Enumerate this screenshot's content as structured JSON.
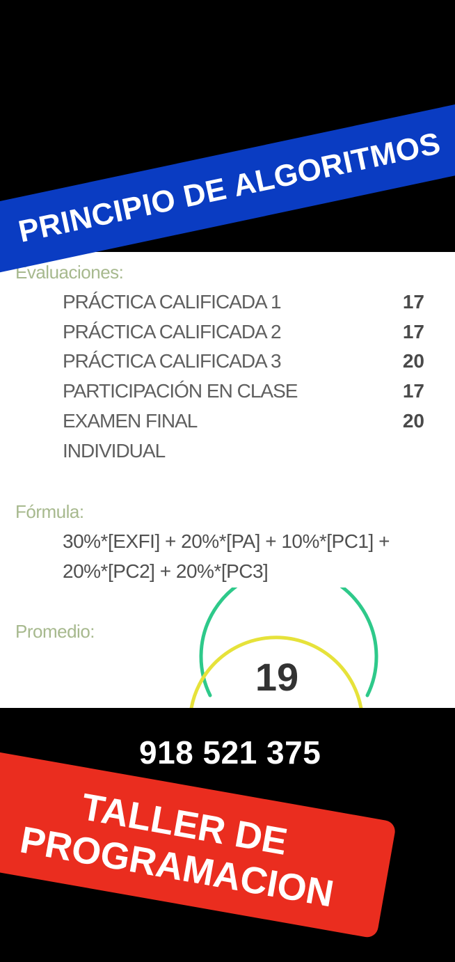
{
  "title_banner": {
    "text": "PRINCIPIO DE ALGORITMOS",
    "color": "#0a3cc2"
  },
  "evaluations": {
    "label": "Evaluaciones:",
    "items": [
      {
        "name": "PRÁCTICA CALIFICADA 1",
        "score": "17"
      },
      {
        "name": "PRÁCTICA CALIFICADA 2",
        "score": "17"
      },
      {
        "name": "PRÁCTICA CALIFICADA 3",
        "score": "20"
      },
      {
        "name": "PARTICIPACIÓN EN CLASE",
        "score": "17"
      },
      {
        "name": "EXAMEN FINAL",
        "name_continued": "INDIVIDUAL",
        "score": "20"
      }
    ]
  },
  "formula": {
    "label": "Fórmula:",
    "line1": "30%*[EXFI] + 20%*[PA] + 10%*[PC1] +",
    "line2": "20%*[PC2] + 20%*[PC3]"
  },
  "average": {
    "label": "Promedio:",
    "value": "19",
    "gauge_colors": {
      "outer": "#2ec98a",
      "inner": "#e6e23a"
    }
  },
  "phone": "918 521 375",
  "workshop_banner": {
    "line1": "TALLER DE",
    "line2": "PROGRAMACION",
    "color": "#ea2d1f"
  }
}
